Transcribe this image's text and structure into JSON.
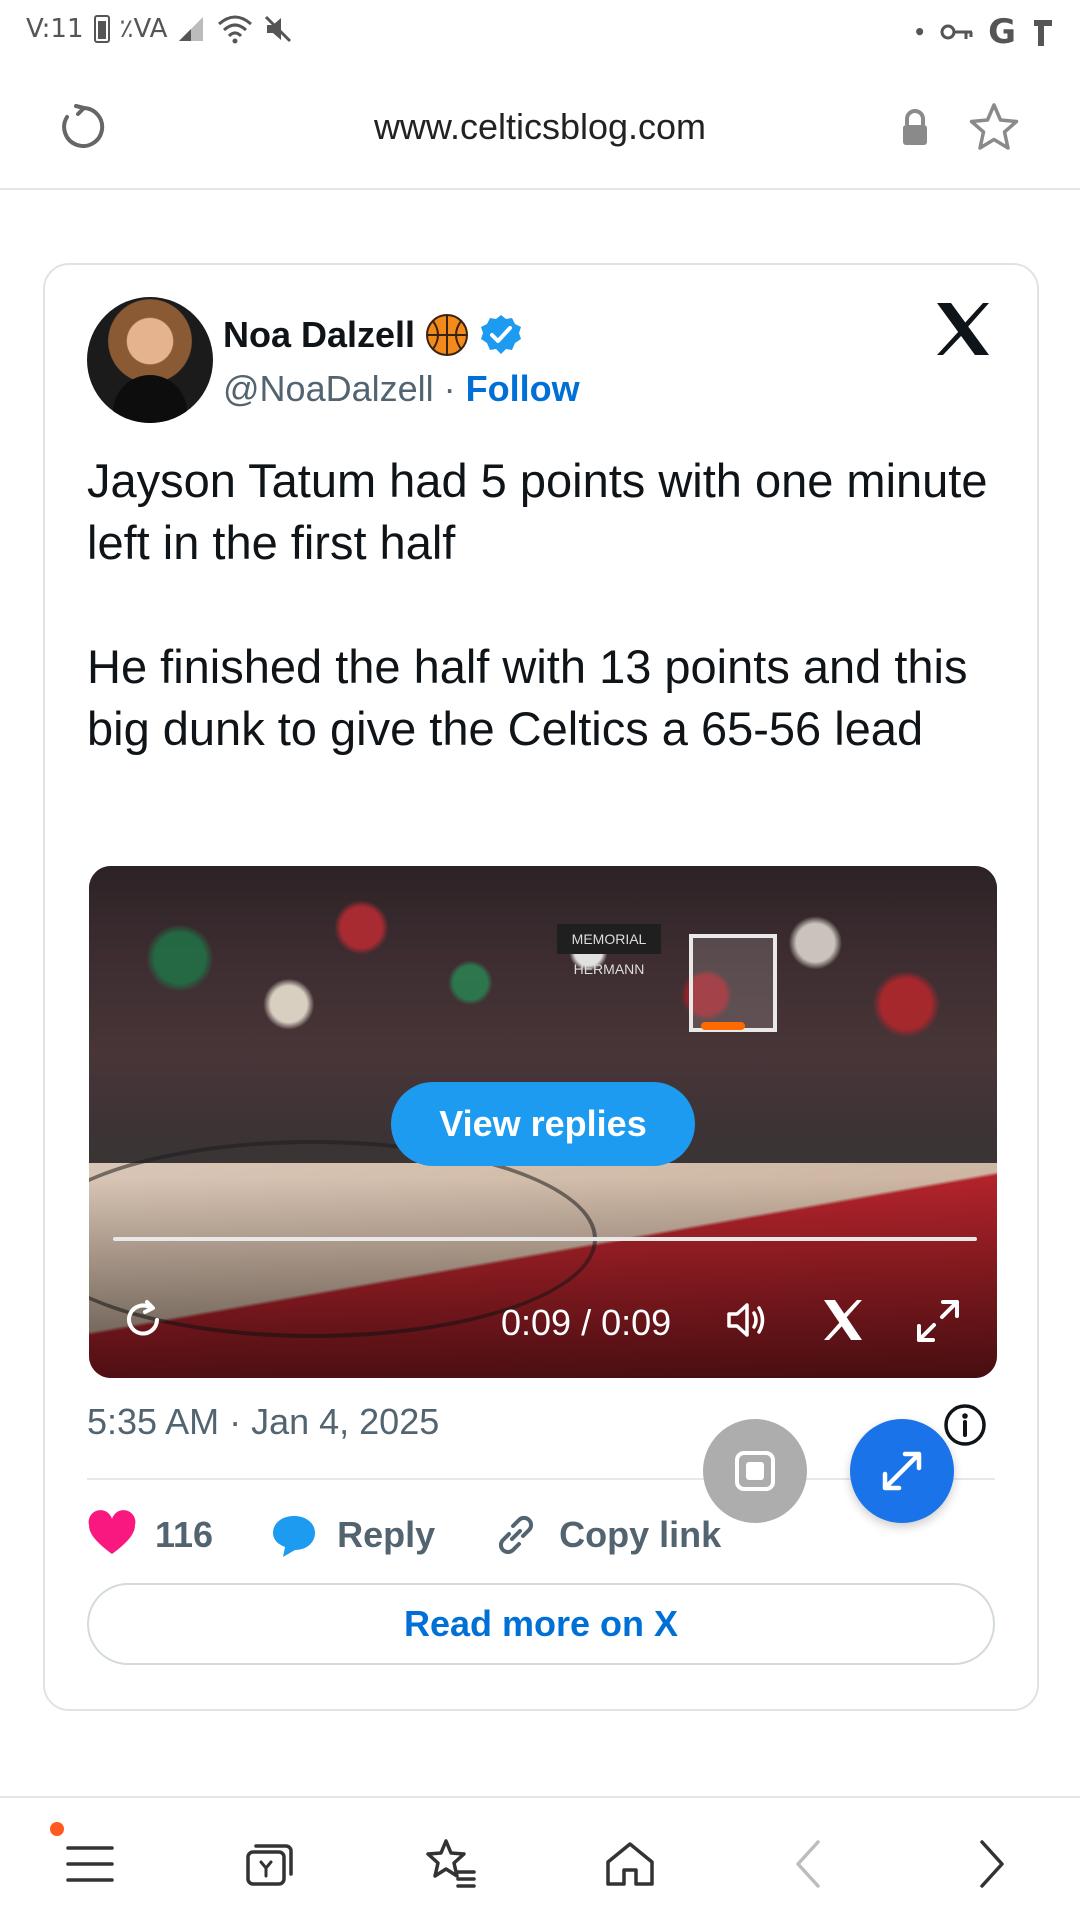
{
  "status_bar": {
    "time": "V:11",
    "battery_percent": "٪VA",
    "right_letters": "G"
  },
  "browser": {
    "url": "www.celticsblog.com"
  },
  "tweet": {
    "author_name": "Noa Dalzell",
    "handle": "@NoaDalzell",
    "separator": " · ",
    "follow_label": "Follow",
    "text": "Jayson Tatum had 5 points with one minute left in the first half\n\nHe finished the half with 13 points and this big dunk to give the Celtics a 65-56 lead",
    "video": {
      "view_replies_label": "View replies",
      "time": "0:09 / 0:09",
      "banner_text": "MEMORIAL HERMANN"
    },
    "datetime": "5:35 AM · Jan 4, 2025",
    "likes": "116",
    "reply_label": "Reply",
    "copy_link_label": "Copy link",
    "read_more_label": "Read more on X"
  },
  "colors": {
    "accent_blue": "#1d9bf0",
    "link_blue": "#006fd6",
    "heart_pink": "#f91880",
    "fab_blue": "#1a73e8"
  },
  "icons": {
    "status": [
      "battery-icon",
      "signal-icon",
      "wifi-icon",
      "mute-icon",
      "key-icon"
    ],
    "nav": [
      "menu-icon",
      "tabs-icon",
      "bookmarks-icon",
      "home-icon",
      "back-icon",
      "forward-icon"
    ]
  }
}
